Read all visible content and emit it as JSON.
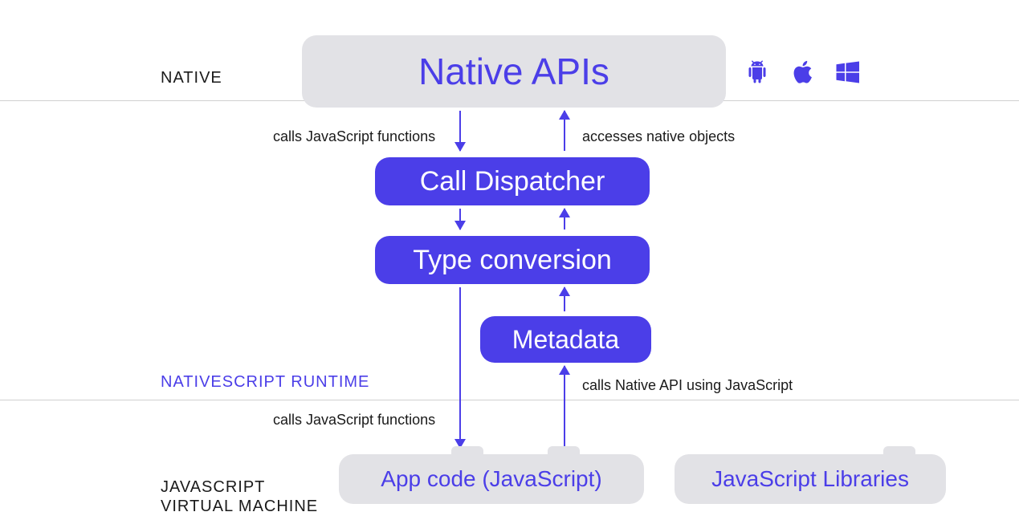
{
  "colors": {
    "accent": "#4b3ee8",
    "grey_box": "#e2e2e6",
    "text": "#1a1a1a"
  },
  "sections": {
    "native": "NATIVE",
    "runtime": "NATIVESCRIPT RUNTIME",
    "jsvm_line1": "JAVASCRIPT",
    "jsvm_line2": "VIRTUAL MACHINE"
  },
  "boxes": {
    "native_apis": "Native APIs",
    "call_dispatcher": "Call Dispatcher",
    "type_conversion": "Type conversion",
    "metadata": "Metadata",
    "app_code": "App code (JavaScript)",
    "js_libraries": "JavaScript Libraries"
  },
  "captions": {
    "left_top": "calls JavaScript functions",
    "right_top": "accesses native objects",
    "right_bottom": "calls Native API using JavaScript",
    "left_bottom": "calls JavaScript functions"
  },
  "platform_icons": [
    "android-icon",
    "apple-icon",
    "windows-icon"
  ]
}
